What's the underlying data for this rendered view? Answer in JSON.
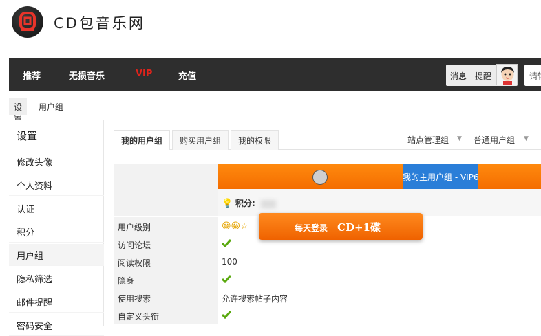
{
  "site": {
    "name": "CD包音乐网"
  },
  "nav": {
    "items": [
      "推荐",
      "无损音乐",
      "VIP",
      "充值"
    ],
    "messages": "消息",
    "reminders": "提醒",
    "search_placeholder": "请输"
  },
  "breadcrumb": [
    "设置",
    "用户组"
  ],
  "sidebar": {
    "title": "设置",
    "items": [
      "修改头像",
      "个人资料",
      "认证",
      "积分",
      "用户组",
      "隐私筛选",
      "邮件提醒",
      "密码安全"
    ],
    "active": "用户组"
  },
  "tabs": [
    "我的用户组",
    "购买用户组",
    "我的权限"
  ],
  "group_links": [
    "站点管理组",
    "普通用户组"
  ],
  "group_banner": "我的主用户组 - VIP6",
  "score": {
    "label": "积分:"
  },
  "rows": [
    {
      "label": "用户级别",
      "value": ""
    },
    {
      "label": "访问论坛",
      "value": "check"
    },
    {
      "label": "阅读权限",
      "value": "100"
    },
    {
      "label": "隐身",
      "value": "check"
    },
    {
      "label": "使用搜索",
      "value": "允许搜索帖子内容"
    },
    {
      "label": "自定义头衔",
      "value": "check"
    }
  ],
  "toast": {
    "text": "每天登录",
    "bonus": "CD+1碟"
  },
  "colors": {
    "accent": "#f46d00",
    "vip": "#e0231b",
    "check": "#5aa90f",
    "band": "#2a7ed8"
  }
}
